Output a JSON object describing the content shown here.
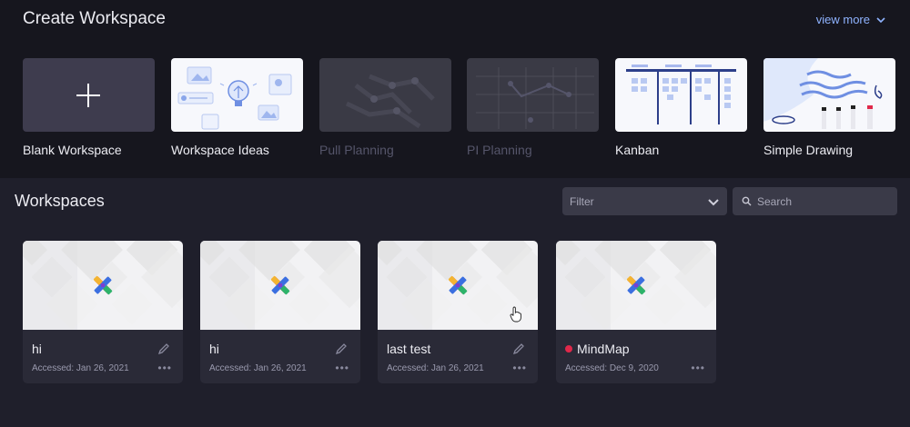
{
  "create": {
    "title": "Create Workspace",
    "view_more": "view more",
    "templates": [
      {
        "label": "Blank Workspace",
        "enabled": true
      },
      {
        "label": "Workspace Ideas",
        "enabled": true
      },
      {
        "label": "Pull Planning",
        "enabled": false
      },
      {
        "label": "PI Planning",
        "enabled": false
      },
      {
        "label": "Kanban",
        "enabled": true
      },
      {
        "label": "Simple Drawing",
        "enabled": true
      }
    ]
  },
  "workspaces": {
    "title": "Workspaces",
    "filter": {
      "value": "Filter"
    },
    "search": {
      "placeholder": "Search"
    },
    "cards": [
      {
        "name": "hi",
        "accessed": "Accessed: Jan 26, 2021"
      },
      {
        "name": "hi",
        "accessed": "Accessed: Jan 26, 2021"
      },
      {
        "name": "last test",
        "accessed": "Accessed: Jan 26, 2021"
      },
      {
        "name": "MindMap",
        "accessed": "Accessed: Dec 9, 2020"
      }
    ]
  },
  "colors": {
    "top_bg": "#16161e",
    "body_bg": "#1f1f2b",
    "accent_link": "#8fb3ff",
    "card_bg": "#2a2a37",
    "mindmap_dot": "#e0284a"
  },
  "icons": [
    "plus-icon",
    "chevron-down-icon",
    "search-icon",
    "pencil-icon",
    "more-dots-icon",
    "app-logo-icon",
    "pointer-cursor-icon"
  ]
}
